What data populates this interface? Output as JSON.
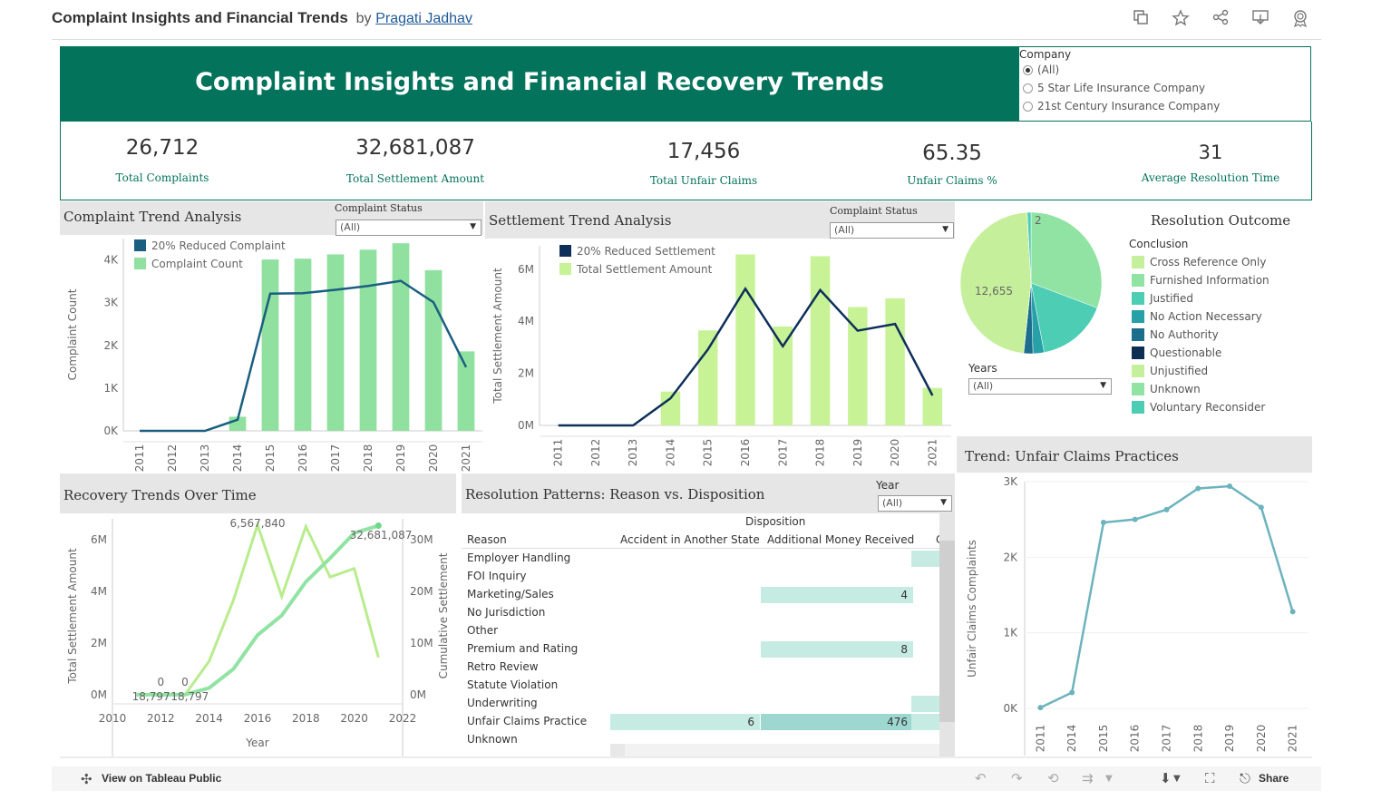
{
  "topbar": {
    "title": "Complaint Insights and Financial Trends",
    "by": "by",
    "author": "Pragati Jadhav",
    "icons": [
      "copy-icon",
      "star-icon",
      "share-network-icon",
      "download-icon",
      "badge-icon"
    ]
  },
  "header": {
    "title": "Complaint Insights and Financial Recovery Trends",
    "color": "#04735c"
  },
  "company_filter": {
    "label": "Company",
    "options": [
      "(All)",
      "5 Star Life Insurance Company",
      "21st Century Insurance Company"
    ],
    "selected": "(All)"
  },
  "kpis": [
    {
      "value": "26,712",
      "label": "Total Complaints"
    },
    {
      "value": "32,681,087",
      "label": "Total Settlement Amount"
    },
    {
      "value": "17,456",
      "label": "Total Unfair Claims"
    },
    {
      "value": "65.35",
      "label": "Unfair Claims %"
    },
    {
      "value": "31",
      "label": "Average Resolution Time"
    }
  ],
  "complaint_trend": {
    "title": "Complaint Trend Analysis",
    "filter_label": "Complaint Status",
    "filter_value": "(All)"
  },
  "settlement_trend": {
    "title": "Settlement Trend Analysis",
    "filter_label": "Complaint Status",
    "filter_value": "(All)"
  },
  "resolution_outcome": {
    "title": "Resolution Outcome",
    "legend_title": "Conclusion",
    "years_label": "Years",
    "years_value": "(All)"
  },
  "recovery": {
    "title": "Recovery Trends Over Time"
  },
  "resolution_patterns": {
    "title": "Resolution Patterns: Reason vs. Disposition",
    "filter_label": "Year",
    "filter_value": "(All)",
    "disposition_header": "Disposition",
    "reason_header": "Reason",
    "columns": [
      "Accident in Another State",
      "Additional Money Received",
      "C"
    ],
    "rows": [
      "Employer Handling",
      "FOI Inquiry",
      "Marketing/Sales",
      "No Jurisdiction",
      "Other",
      "Premium and Rating",
      "Retro Review",
      "Statute Violation",
      "Underwriting",
      "Unfair Claims Practice",
      "Unknown"
    ],
    "cells": [
      {
        "row": 0,
        "col": 2,
        "value": ""
      },
      {
        "row": 2,
        "col": 1,
        "value": "4"
      },
      {
        "row": 5,
        "col": 1,
        "value": "8"
      },
      {
        "row": 8,
        "col": 2,
        "value": ""
      },
      {
        "row": 9,
        "col": 0,
        "value": "6"
      },
      {
        "row": 9,
        "col": 1,
        "value": "476"
      },
      {
        "row": 9,
        "col": 2,
        "value": ""
      }
    ]
  },
  "unfair_trend": {
    "title": "Trend: Unfair Claims Practices"
  },
  "bottom_bar": {
    "view_label": "View on Tableau Public",
    "share_label": "Share"
  },
  "chart_data": [
    {
      "id": "complaint-trend",
      "type": "bar",
      "categories": [
        "2011",
        "2012",
        "2013",
        "2014",
        "2015",
        "2016",
        "2017",
        "2018",
        "2019",
        "2020",
        "2021"
      ],
      "series": [
        {
          "name": "Complaint Count",
          "kind": "bar",
          "color": "#90e0a0",
          "values": [
            0,
            0,
            0,
            330,
            4010,
            4030,
            4130,
            4240,
            4390,
            3760,
            1860
          ]
        },
        {
          "name": "20% Reduced Complaint",
          "kind": "line",
          "color": "#1a5f80",
          "values": [
            0,
            0,
            0,
            260,
            3210,
            3220,
            3300,
            3390,
            3510,
            3010,
            1490
          ]
        }
      ],
      "ylabel": "Complaint Count",
      "ylim": [
        0,
        4500
      ],
      "yticks": [
        0,
        1000,
        2000,
        3000,
        4000
      ],
      "ytick_labels": [
        "0K",
        "1K",
        "2K",
        "3K",
        "4K"
      ]
    },
    {
      "id": "settlement-trend",
      "type": "bar",
      "categories": [
        "2011",
        "2012",
        "2013",
        "2014",
        "2015",
        "2016",
        "2017",
        "2018",
        "2019",
        "2020",
        "2021"
      ],
      "series": [
        {
          "name": "Total Settlement Amount",
          "kind": "bar",
          "color": "#c8f296",
          "values": [
            0,
            0,
            0,
            1300000,
            3650000,
            6570000,
            3800000,
            6500000,
            4550000,
            4880000,
            1440000
          ]
        },
        {
          "name": "20% Reduced Settlement",
          "kind": "line",
          "color": "#0d2f5a",
          "values": [
            0,
            0,
            0,
            1040000,
            2920000,
            5250000,
            3040000,
            5200000,
            3640000,
            3900000,
            1150000
          ]
        }
      ],
      "ylabel": "Total Settlement Amount",
      "ylim": [
        0,
        6900000
      ],
      "yticks": [
        0,
        2000000,
        4000000,
        6000000
      ],
      "ytick_labels": [
        "0M",
        "2M",
        "4M",
        "6M"
      ]
    },
    {
      "id": "resolution-outcome",
      "type": "pie",
      "labels": [
        "Cross Reference Only",
        "Furnished Information",
        "Justified",
        "No Action Necessary",
        "No Authority",
        "Questionable",
        "Unjustified",
        "Unknown",
        "Voluntary Reconsider"
      ],
      "colors": [
        "#c5ef9b",
        "#90e3a3",
        "#4ecdb5",
        "#27a0a8",
        "#1c6e8c",
        "#0c2d54",
        "#c5ef9b",
        "#90e3a3",
        "#4ecdb5"
      ],
      "values": [
        2,
        8200,
        4350,
        680,
        560,
        10,
        12655,
        10,
        230
      ],
      "data_labels": [
        {
          "slice": 0,
          "text": "2"
        },
        {
          "slice": 6,
          "text": "12,655"
        }
      ]
    },
    {
      "id": "recovery-trends",
      "type": "line",
      "x": [
        2011,
        2012,
        2013,
        2014,
        2015,
        2016,
        2017,
        2018,
        2019,
        2020,
        2021
      ],
      "series": [
        {
          "name": "Total Settlement Amount",
          "axis": "left",
          "color": "#b8ec8c",
          "values": [
            0,
            0,
            0,
            1300000,
            3650000,
            6567840,
            3800000,
            6500000,
            4550000,
            4880000,
            1440000
          ]
        },
        {
          "name": "Cumulative Settlement",
          "axis": "right",
          "color": "#90e3a3",
          "values": [
            18797,
            18797,
            18797,
            1318797,
            4968797,
            11536637,
            15336637,
            21836637,
            26386637,
            31266637,
            32681087
          ]
        }
      ],
      "labels": [
        "6,567,840",
        "0",
        "0",
        "18,797",
        "18,797",
        "32,681,087"
      ],
      "xlabel": "Year",
      "ylabel": "Total Settlement Amount",
      "y2label": "Cumulative Settlement",
      "xlim": [
        2010,
        2022
      ],
      "xticks": [
        2010,
        2012,
        2014,
        2016,
        2018,
        2020,
        2022
      ],
      "ylim": [
        0,
        6800000
      ],
      "yticks": [
        0,
        2000000,
        4000000,
        6000000
      ],
      "ytick_labels": [
        "0M",
        "2M",
        "4M",
        "6M"
      ],
      "y2lim": [
        0,
        34000000
      ],
      "y2ticks": [
        0,
        10000000,
        20000000,
        30000000
      ],
      "y2tick_labels": [
        "0M",
        "10M",
        "20M",
        "30M"
      ]
    },
    {
      "id": "unfair-claims-trend",
      "type": "line",
      "categories": [
        "2011",
        "2014",
        "2015",
        "2016",
        "2017",
        "2018",
        "2019",
        "2020",
        "2021"
      ],
      "series": [
        {
          "name": "Unfair Claims Complaints",
          "color": "#6db3bd",
          "values": [
            10,
            210,
            2460,
            2500,
            2630,
            2910,
            2940,
            2660,
            1280
          ]
        }
      ],
      "ylabel": "Unfair Claims Complaints",
      "ylim": [
        0,
        3000
      ],
      "yticks": [
        0,
        1000,
        2000,
        3000
      ],
      "ytick_labels": [
        "0K",
        "1K",
        "2K",
        "3K"
      ]
    }
  ]
}
